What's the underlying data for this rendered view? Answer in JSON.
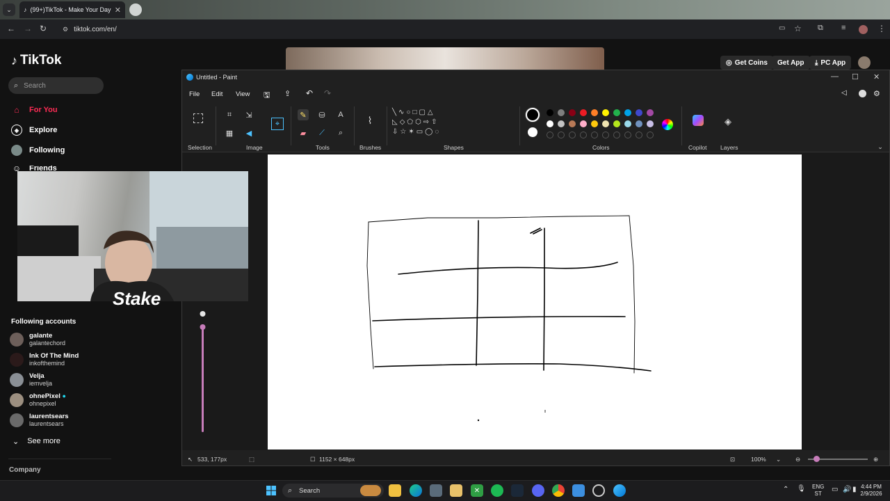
{
  "browser": {
    "tab_title": "(99+)TikTok - Make Your Day",
    "url": "tiktok.com/en/"
  },
  "tiktok": {
    "logo": "TikTok",
    "search_placeholder": "Search",
    "nav": [
      {
        "label": "For You",
        "icon": "home-icon",
        "color": "#fe2c55"
      },
      {
        "label": "Explore",
        "icon": "compass-icon"
      },
      {
        "label": "Following",
        "icon": "following-avatar-icon"
      },
      {
        "label": "Friends",
        "icon": "friends-icon"
      }
    ],
    "following_heading": "Following accounts",
    "accounts": [
      {
        "name": "galante",
        "handle": "galantechord"
      },
      {
        "name": "Ink Of The Mind",
        "handle": "inkofthemind"
      },
      {
        "name": "Velja",
        "handle": "iemvelja"
      },
      {
        "name": "ohnePixel",
        "handle": "ohnepixel",
        "verified": true
      },
      {
        "name": "laurentsears",
        "handle": "laurentsears"
      }
    ],
    "see_more": "See more",
    "company": "Company",
    "top_buttons": {
      "coins": "Get Coins",
      "app": "Get App",
      "pc": "PC App"
    }
  },
  "webcam": {
    "overlay_logo": "Stake"
  },
  "paint": {
    "title": "Untitled - Paint",
    "menu": [
      "File",
      "Edit",
      "View"
    ],
    "groups": [
      "Selection",
      "Image",
      "Tools",
      "Brushes",
      "Shapes",
      "Colors",
      "Copilot",
      "Layers"
    ],
    "palette": [
      "#000000",
      "#7f7f7f",
      "#880015",
      "#ed1c24",
      "#ff7f27",
      "#fff200",
      "#22b14c",
      "#00a2e8",
      "#3f48cc",
      "#a349a4",
      "#ffffff",
      "#c3c3c3",
      "#b97a57",
      "#ffaec9",
      "#ffc90e",
      "#efe4b0",
      "#b5e61d",
      "#99d9ea",
      "#7092be",
      "#c8bfe7"
    ],
    "status": {
      "cursor_pos": "533, 177px",
      "canvas_size": "1152 × 648px",
      "zoom": "100%"
    }
  },
  "taskbar": {
    "search": "Search",
    "lang_top": "ENG",
    "lang_bottom": "ST",
    "time": "4:44 PM",
    "date": "2/9/2026"
  }
}
